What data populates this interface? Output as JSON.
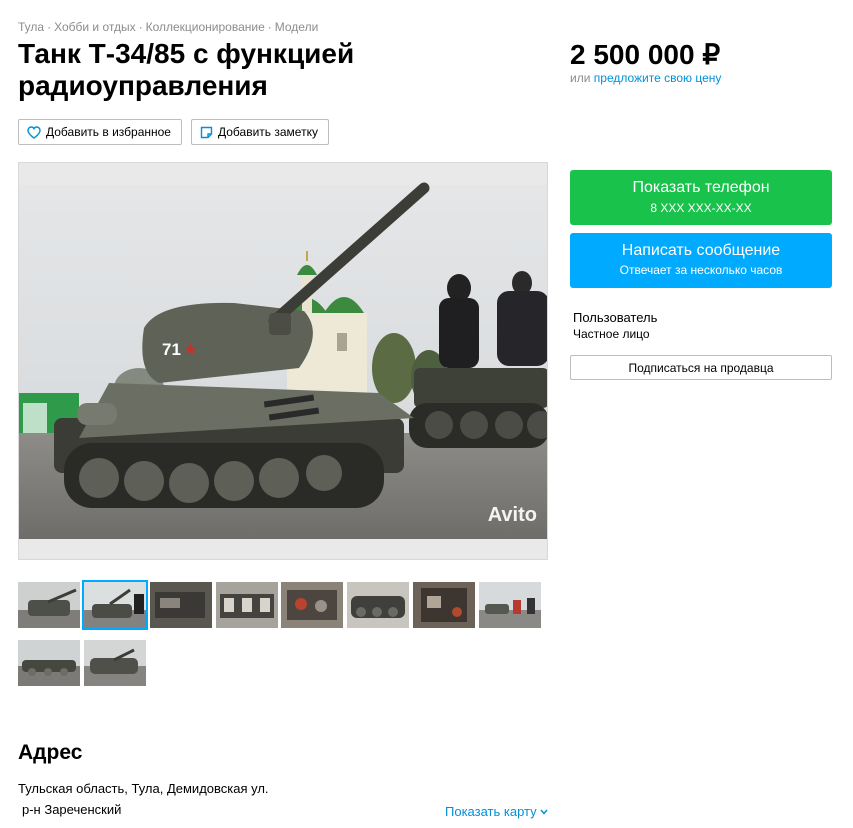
{
  "breadcrumbs": {
    "items": [
      "Тула",
      "Хобби и отдых",
      "Коллекционирование",
      "Модели"
    ],
    "separator": "·"
  },
  "listing": {
    "title": "Танк Т-34/85 с функцией радиоуправления",
    "price": "2 500 000 ₽",
    "price_offer_prefix": "или",
    "price_offer_link": "предложите свою цену"
  },
  "actions": {
    "favorite_label": "Добавить в избранное",
    "note_label": "Добавить заметку"
  },
  "gallery": {
    "watermark": "Avito",
    "thumbnails_count": 10,
    "active_index": 1
  },
  "contact": {
    "phone_label": "Показать телефон",
    "phone_masked": "8 XXX XXX-XX-XX",
    "message_label": "Написать сообщение",
    "message_sub": "Отвечает за несколько часов"
  },
  "seller": {
    "name": "Пользователь",
    "type": "Частное лицо",
    "subscribe_label": "Подписаться на продавца"
  },
  "address": {
    "heading": "Адрес",
    "line": "Тульская область, Тула, Демидовская ул.",
    "district": "р-н Зареченский",
    "map_link": "Показать карту"
  },
  "colors": {
    "accent_link": "#0091d9",
    "phone_button": "#19c34b",
    "message_button": "#00aaff"
  }
}
